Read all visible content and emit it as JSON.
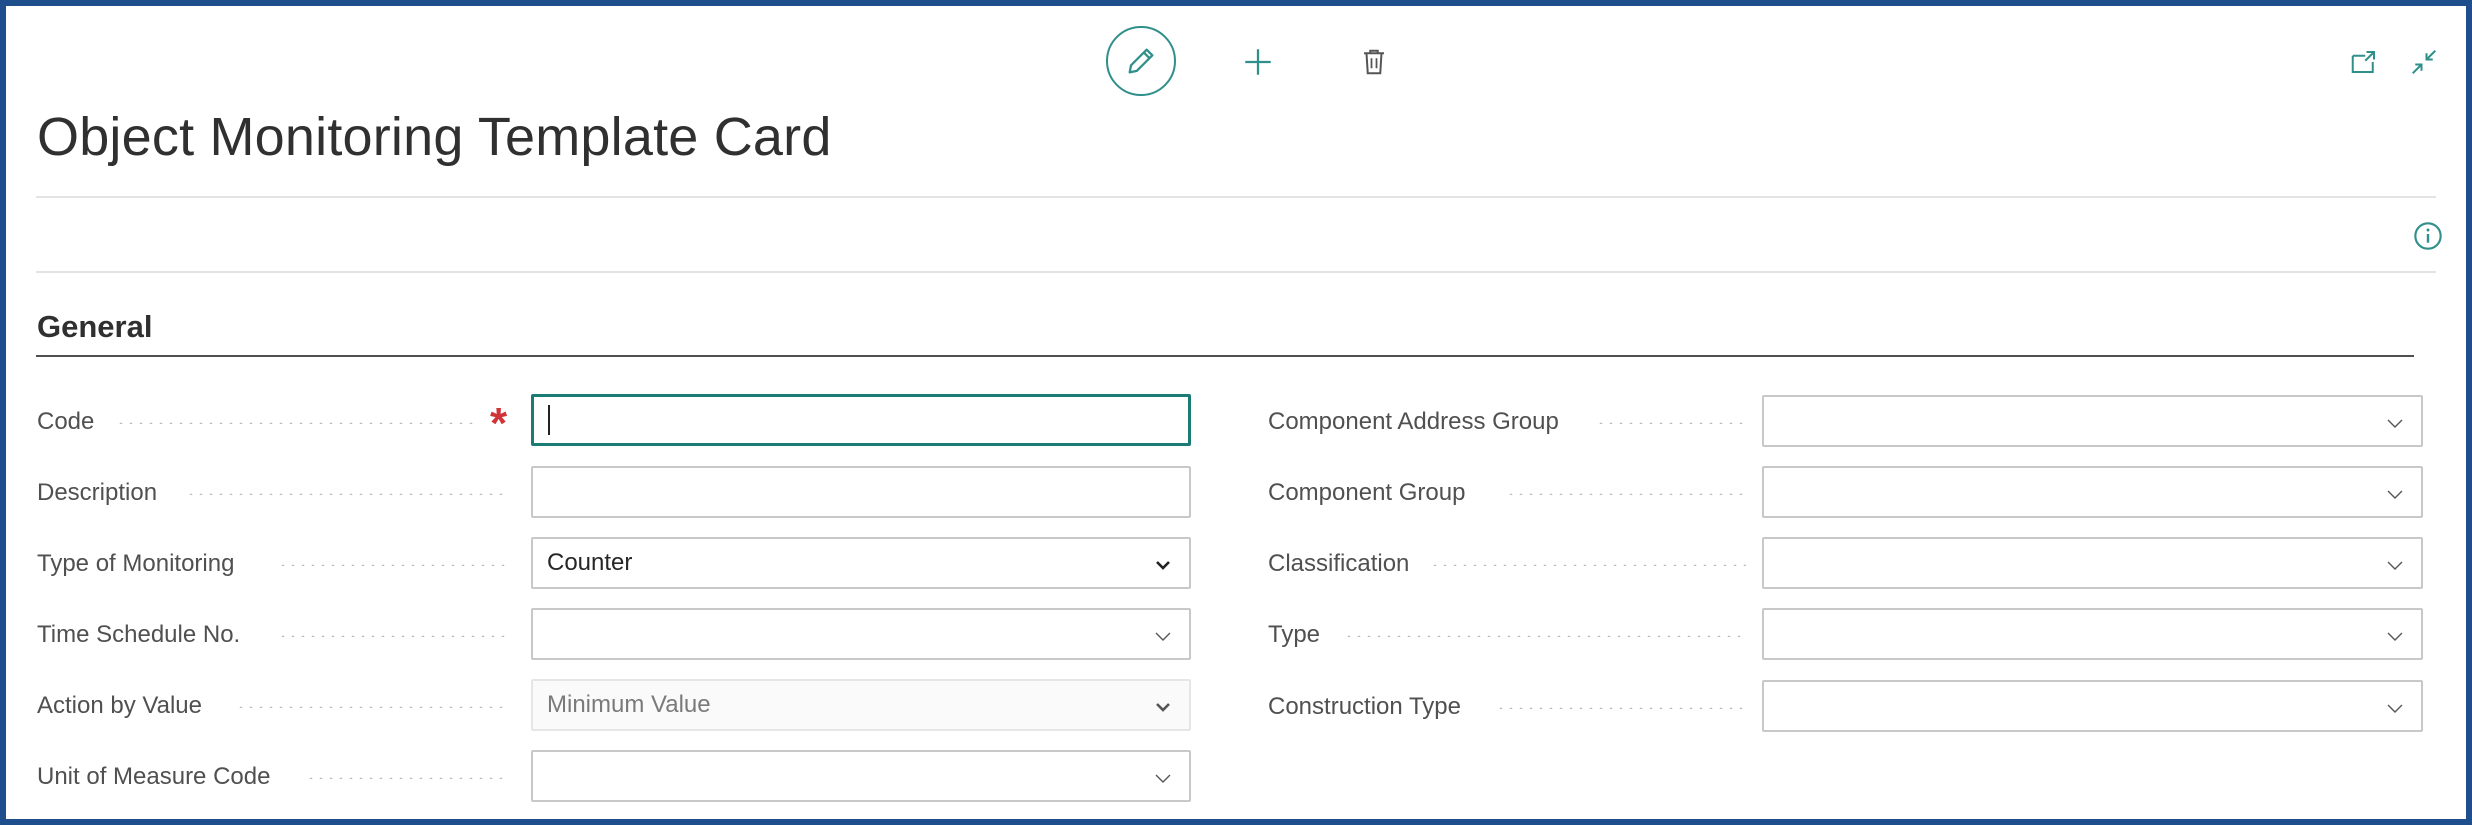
{
  "page": {
    "title": "Object Monitoring Template Card",
    "section": "General"
  },
  "toolbar": {
    "edit_icon": "pencil-icon",
    "new_icon": "plus-icon",
    "delete_icon": "trash-icon",
    "open_new_window_icon": "open-in-new-window-icon",
    "collapse_icon": "collapse-icon",
    "info_icon": "info-icon"
  },
  "colors": {
    "accent": "#2f8f8a",
    "frame": "#1f4e8c",
    "required": "#d13438"
  },
  "left_fields": [
    {
      "label": "Code",
      "value": "",
      "required": true,
      "focused": true
    },
    {
      "label": "Description",
      "value": ""
    },
    {
      "label": "Type of Monitoring",
      "value": "Counter"
    },
    {
      "label": "Time Schedule No.",
      "value": ""
    },
    {
      "label": "Action by Value",
      "value": "Minimum Value",
      "disabled": true
    },
    {
      "label": "Unit of Measure Code",
      "value": ""
    }
  ],
  "right_fields": [
    {
      "label": "Component Address Group",
      "value": ""
    },
    {
      "label": "Component Group",
      "value": ""
    },
    {
      "label": "Classification",
      "value": ""
    },
    {
      "label": "Type",
      "value": ""
    },
    {
      "label": "Construction Type",
      "value": ""
    }
  ]
}
